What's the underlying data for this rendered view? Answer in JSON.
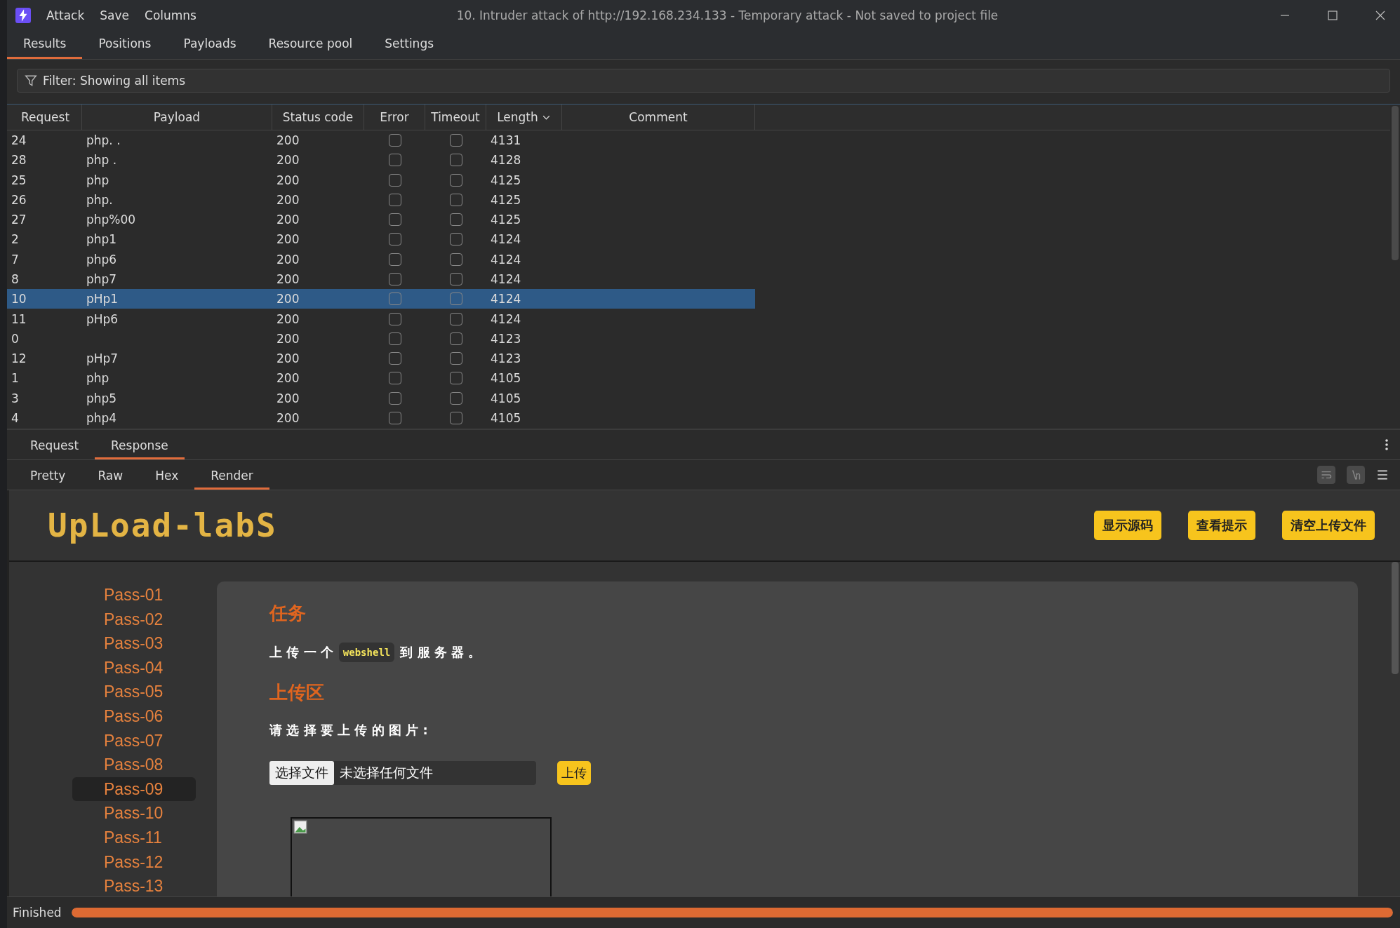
{
  "menu": [
    "Attack",
    "Save",
    "Columns"
  ],
  "window": {
    "title": "10. Intruder attack of http://192.168.234.133 - Temporary attack - Not saved to project file"
  },
  "tabs": [
    {
      "label": "Results",
      "selected": true
    },
    {
      "label": "Positions",
      "selected": false
    },
    {
      "label": "Payloads",
      "selected": false
    },
    {
      "label": "Resource pool",
      "selected": false
    },
    {
      "label": "Settings",
      "selected": false
    }
  ],
  "filter": {
    "text": "Filter: Showing all items"
  },
  "table": {
    "columns": [
      {
        "label": "Request",
        "sorted": false
      },
      {
        "label": "Payload",
        "sorted": false
      },
      {
        "label": "Status code",
        "sorted": false
      },
      {
        "label": "Error",
        "sorted": false
      },
      {
        "label": "Timeout",
        "sorted": false
      },
      {
        "label": "Length",
        "sorted": true
      },
      {
        "label": "Comment",
        "sorted": false
      }
    ],
    "rows": [
      {
        "request": "24",
        "payload": "php. .",
        "status": "200",
        "error": false,
        "timeout": false,
        "length": "4131",
        "selected": false
      },
      {
        "request": "28",
        "payload": "php .",
        "status": "200",
        "error": false,
        "timeout": false,
        "length": "4128",
        "selected": false
      },
      {
        "request": "25",
        "payload": "php",
        "status": "200",
        "error": false,
        "timeout": false,
        "length": "4125",
        "selected": false
      },
      {
        "request": "26",
        "payload": "php.",
        "status": "200",
        "error": false,
        "timeout": false,
        "length": "4125",
        "selected": false
      },
      {
        "request": "27",
        "payload": "php%00",
        "status": "200",
        "error": false,
        "timeout": false,
        "length": "4125",
        "selected": false
      },
      {
        "request": "2",
        "payload": "php1",
        "status": "200",
        "error": false,
        "timeout": false,
        "length": "4124",
        "selected": false
      },
      {
        "request": "7",
        "payload": "php6",
        "status": "200",
        "error": false,
        "timeout": false,
        "length": "4124",
        "selected": false
      },
      {
        "request": "8",
        "payload": "php7",
        "status": "200",
        "error": false,
        "timeout": false,
        "length": "4124",
        "selected": false
      },
      {
        "request": "10",
        "payload": "pHp1",
        "status": "200",
        "error": false,
        "timeout": false,
        "length": "4124",
        "selected": true
      },
      {
        "request": "11",
        "payload": "pHp6",
        "status": "200",
        "error": false,
        "timeout": false,
        "length": "4124",
        "selected": false
      },
      {
        "request": "0",
        "payload": "",
        "status": "200",
        "error": false,
        "timeout": false,
        "length": "4123",
        "selected": false
      },
      {
        "request": "12",
        "payload": "pHp7",
        "status": "200",
        "error": false,
        "timeout": false,
        "length": "4123",
        "selected": false
      },
      {
        "request": "1",
        "payload": "php",
        "status": "200",
        "error": false,
        "timeout": false,
        "length": "4105",
        "selected": false
      },
      {
        "request": "3",
        "payload": "php5",
        "status": "200",
        "error": false,
        "timeout": false,
        "length": "4105",
        "selected": false
      },
      {
        "request": "4",
        "payload": "php4",
        "status": "200",
        "error": false,
        "timeout": false,
        "length": "4105",
        "selected": false
      }
    ]
  },
  "message_tabs": [
    {
      "label": "Request",
      "selected": false
    },
    {
      "label": "Response",
      "selected": true
    }
  ],
  "view_tabs": [
    {
      "label": "Pretty",
      "selected": false
    },
    {
      "label": "Raw",
      "selected": false
    },
    {
      "label": "Hex",
      "selected": false
    },
    {
      "label": "Render",
      "selected": true
    }
  ],
  "render": {
    "logo": "UpLoad-labS",
    "header_buttons": [
      "显示源码",
      "查看提示",
      "清空上传文件"
    ],
    "nav": [
      {
        "label": "Pass-01",
        "selected": false
      },
      {
        "label": "Pass-02",
        "selected": false
      },
      {
        "label": "Pass-03",
        "selected": false
      },
      {
        "label": "Pass-04",
        "selected": false
      },
      {
        "label": "Pass-05",
        "selected": false
      },
      {
        "label": "Pass-06",
        "selected": false
      },
      {
        "label": "Pass-07",
        "selected": false
      },
      {
        "label": "Pass-08",
        "selected": false
      },
      {
        "label": "Pass-09",
        "selected": true
      },
      {
        "label": "Pass-10",
        "selected": false
      },
      {
        "label": "Pass-11",
        "selected": false
      },
      {
        "label": "Pass-12",
        "selected": false
      },
      {
        "label": "Pass-13",
        "selected": false
      }
    ],
    "task_heading": "任务",
    "task_before": "上 传 一 个",
    "task_code": "webshell",
    "task_after": "到 服 务 器 。",
    "upload_heading": "上传区",
    "prompt": "请 选 择 要 上 传 的 图 片 :",
    "file_button": "选择文件",
    "file_status": "未选择任何文件",
    "upload_button": "上传"
  },
  "status_bar": {
    "text": "Finished",
    "level": 1
  }
}
